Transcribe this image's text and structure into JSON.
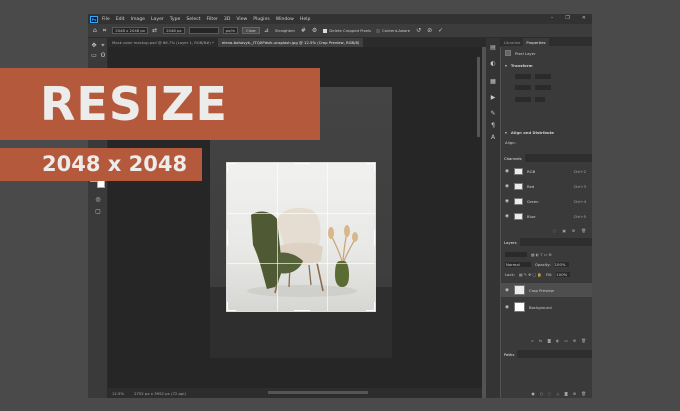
{
  "menu": {
    "app_icon": "Ps",
    "items": [
      "File",
      "Edit",
      "Image",
      "Layer",
      "Type",
      "Select",
      "Filter",
      "3D",
      "View",
      "Plugins",
      "Window",
      "Help"
    ]
  },
  "options": {
    "ratio": "2048 x 2048 px",
    "res_value": "2048 px",
    "res_unit": "px/in",
    "clear_label": "Clear",
    "straighten_label": "Straighten",
    "delete_cropped_label": "Delete Cropped Pixels",
    "content_aware_label": "Content-Aware"
  },
  "tabs": [
    {
      "label": "Mock color mockup.psd @ 66.7% (Layer 1, RGB/8#) *",
      "active": false
    },
    {
      "label": "elena-bohovyk-_fTQXPdslk-unsplash.jpg @ 12.5% (Crop Preview, RGB/8)",
      "active": true
    }
  ],
  "status": {
    "zoom": "12.5%",
    "doc_size": "2752 px x 3952 px (72 ppi)"
  },
  "panels": {
    "top_tabs": [
      "Libraries",
      "Properties"
    ],
    "pixel_layer": "Pixel Layer",
    "transform": "Transform",
    "align": "Align and Distribute",
    "align_sub": "Align:",
    "channels_title": "Channels",
    "channels": [
      {
        "name": "RGB",
        "shortcut": "Ctrl+2"
      },
      {
        "name": "Red",
        "shortcut": "Ctrl+3"
      },
      {
        "name": "Green",
        "shortcut": "Ctrl+4"
      },
      {
        "name": "Blue",
        "shortcut": "Ctrl+5"
      }
    ],
    "layers_title": "Layers",
    "blend_mode": "Normal",
    "opacity_label": "Opacity:",
    "opacity": "100%",
    "lock_label": "Lock:",
    "fill_label": "Fill:",
    "fill": "100%",
    "layers": [
      {
        "name": "Crop Preview"
      },
      {
        "name": "Background"
      }
    ],
    "paths_title": "Paths"
  },
  "overlay": {
    "title": "RESIZE",
    "subtitle": "2048 x 2048"
  },
  "colors": {
    "banner": "#b5593d",
    "banner_text": "#ececea",
    "accent": "#31a8ff"
  }
}
